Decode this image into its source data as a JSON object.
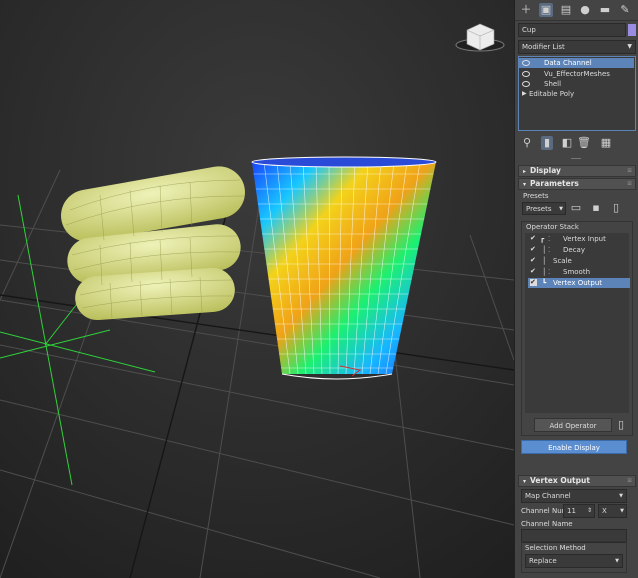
{
  "object_name": "Cup",
  "modifier_list_label": "Modifier List",
  "modifier_stack": [
    {
      "label": "Data Channel",
      "selected": true,
      "eye": true
    },
    {
      "label": "Vu_EffectorMeshes",
      "selected": false,
      "eye": true
    },
    {
      "label": "Shell",
      "selected": false,
      "eye": true
    },
    {
      "label": "Editable Poly",
      "selected": false,
      "eye": false
    }
  ],
  "rollouts": {
    "display": "Display",
    "parameters": "Parameters",
    "vertex_output": "Vertex Output"
  },
  "presets": {
    "label": "Presets",
    "dropdown": "Presets"
  },
  "operator_stack": {
    "label": "Operator Stack",
    "items": [
      {
        "label": "Vertex Input",
        "selected": false
      },
      {
        "label": "Decay",
        "selected": false
      },
      {
        "label": "Scale",
        "selected": false
      },
      {
        "label": "Smooth",
        "selected": false
      },
      {
        "label": "Vertex Output",
        "selected": true
      }
    ],
    "add_operator": "Add Operator"
  },
  "enable_display": "Enable Display",
  "vertex_output": {
    "map_channel": "Map Channel",
    "channel_num_label": "Channel Num",
    "channel_num_value": "11",
    "axis_value": "X",
    "channel_name_label": "Channel Name",
    "channel_name_value": "",
    "selection_method_label": "Selection Method",
    "selection_method_value": "Replace"
  },
  "colors": {
    "accent_blue": "#5b8ed0",
    "selection_blue": "#5d84b8",
    "capsule_yellow": "#e2e89a",
    "swatch": "#9a8ce0"
  }
}
